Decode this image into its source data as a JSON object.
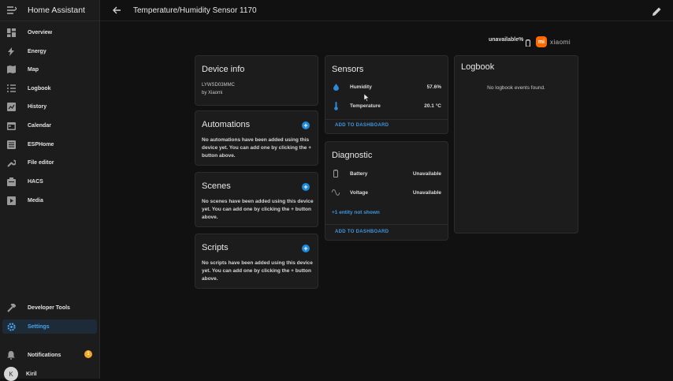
{
  "sidebar": {
    "title": "Home Assistant",
    "items": [
      {
        "label": "Overview",
        "icon": "grid-icon"
      },
      {
        "label": "Energy",
        "icon": "lightning-icon"
      },
      {
        "label": "Map",
        "icon": "map-icon"
      },
      {
        "label": "Logbook",
        "icon": "list-icon"
      },
      {
        "label": "History",
        "icon": "chart-icon"
      },
      {
        "label": "Calendar",
        "icon": "calendar-icon"
      },
      {
        "label": "ESPHome",
        "icon": "chip-icon"
      },
      {
        "label": "File editor",
        "icon": "wrench-icon"
      },
      {
        "label": "HACS",
        "icon": "hacs-icon"
      },
      {
        "label": "Media",
        "icon": "media-icon"
      }
    ],
    "developer_tools": "Developer Tools",
    "settings": "Settings",
    "notifications": "Notifications",
    "notifications_count": "1",
    "user": "Kiril",
    "user_initial": "K"
  },
  "header": {
    "title": "Temperature/Humidity Sensor 1170"
  },
  "device": {
    "status": "unavailable%",
    "brand": "xiaomi",
    "brand_logo": "mi"
  },
  "device_info": {
    "title": "Device info",
    "model": "LYWSD03MMC",
    "manufacturer": "by Xiaomi"
  },
  "automations": {
    "title": "Automations",
    "text": "No automations have been added using this device yet. You can add one by clicking the + button above."
  },
  "scenes": {
    "title": "Scenes",
    "text": "No scenes have been added using this device yet. You can add one by clicking the + button above."
  },
  "scripts": {
    "title": "Scripts",
    "text": "No scripts have been added using this device yet. You can add one by clicking the + button above."
  },
  "sensors": {
    "title": "Sensors",
    "rows": [
      {
        "name": "Humidity",
        "value": "57.6%",
        "icon": "water-drop-icon"
      },
      {
        "name": "Temperature",
        "value": "20.1 °C",
        "icon": "thermometer-icon"
      }
    ],
    "add_to_dashboard": "ADD TO DASHBOARD"
  },
  "diagnostic": {
    "title": "Diagnostic",
    "rows": [
      {
        "name": "Battery",
        "value": "Unavailable",
        "icon": "battery-icon"
      },
      {
        "name": "Voltage",
        "value": "Unavailable",
        "icon": "sine-wave-icon"
      }
    ],
    "hidden_entities": "+1 entity not shown",
    "add_to_dashboard": "ADD TO DASHBOARD"
  },
  "logbook": {
    "title": "Logbook",
    "empty_text": "No logbook events found."
  },
  "colors": {
    "accent": "#1e88d9",
    "link": "#3f97df",
    "brand": "#ff6900",
    "badge": "#f5a623"
  }
}
